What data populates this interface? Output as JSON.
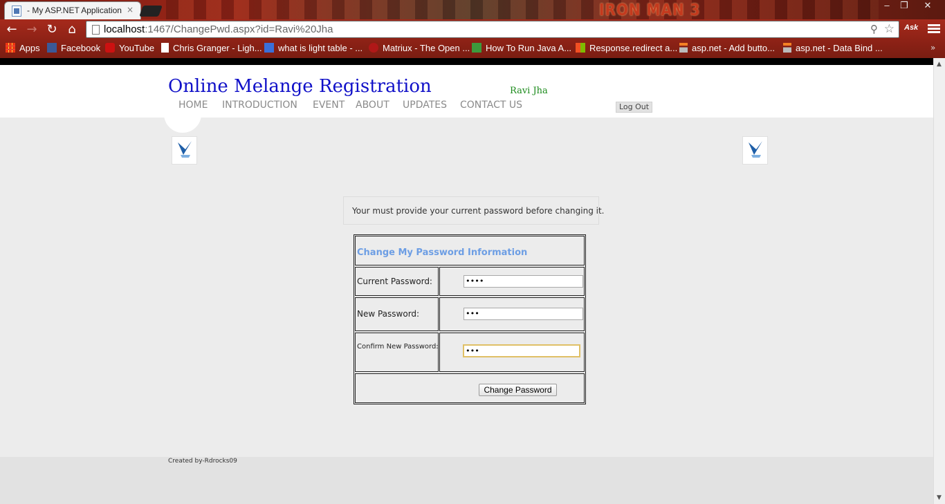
{
  "browser": {
    "tab_title": "- My ASP.NET Application",
    "tab_close": "×",
    "banner_text": "IRON MAN 3",
    "url_host": "localhost",
    "url_rest": ":1467/ChangePwd.aspx?id=Ravi%20Jha",
    "ask_label": "Ask",
    "window_controls": {
      "minimize": "–",
      "restore": "❐",
      "close": "✕"
    },
    "bookmarks": [
      {
        "label": "Apps",
        "icon": "apps-grid-icon"
      },
      {
        "label": "Facebook",
        "icon": "facebook-icon"
      },
      {
        "label": "YouTube",
        "icon": "youtube-icon"
      },
      {
        "label": "Chris Granger - Ligh...",
        "icon": "page-icon"
      },
      {
        "label": "what is light table - ...",
        "icon": "google-icon"
      },
      {
        "label": "Matriux - The Open ...",
        "icon": "matriux-icon"
      },
      {
        "label": "How To Run Java A...",
        "icon": "java-icon"
      },
      {
        "label": "Response.redirect a...",
        "icon": "microsoft-icon"
      },
      {
        "label": "asp.net - Add butto...",
        "icon": "stackoverflow-icon"
      },
      {
        "label": "asp.net - Data Bind ...",
        "icon": "stackoverflow-icon"
      }
    ]
  },
  "site": {
    "title": "Online Melange Registration",
    "username": "Ravi Jha",
    "logout_label": "Log Out",
    "nav": [
      "HOME",
      "INTRODUCTION",
      "EVENT",
      "ABOUT",
      "UPDATES",
      "CONTACT US"
    ]
  },
  "message": "Your must provide your current password before changing it.",
  "form": {
    "heading": "Change My Password Information",
    "current_label": "Current Password:",
    "current_value": "••••",
    "new_label": "New Password:",
    "new_value": "•••",
    "confirm_label": "Confirm New Password:",
    "confirm_value": "•••",
    "submit_label": "Change Password"
  },
  "footer": {
    "credit": "Created by-Rdrocks09"
  },
  "colors": {
    "site_title": "#1010c8",
    "username": "#1a8a1a",
    "form_heading": "#6d9ee4",
    "nav_text": "#8a8a8a"
  }
}
